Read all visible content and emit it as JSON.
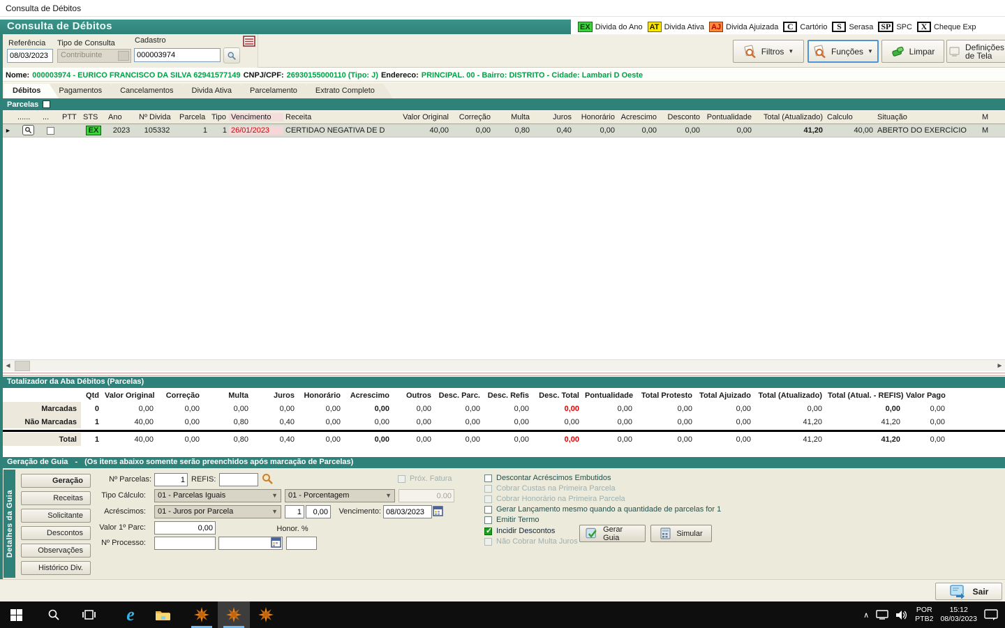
{
  "window": {
    "title": "Consulta de Débitos"
  },
  "header": {
    "title": "Consulta de Débitos"
  },
  "legend": [
    {
      "code": "EX",
      "label": "Divida do Ano"
    },
    {
      "code": "AT",
      "label": "Divida Ativa"
    },
    {
      "code": "AJ",
      "label": "Divida Ajuizada"
    },
    {
      "code": "C",
      "label": "Cartório"
    },
    {
      "code": "S",
      "label": "Serasa"
    },
    {
      "code": "SP",
      "label": "SPC"
    },
    {
      "code": "X",
      "label": "Cheque Exp"
    }
  ],
  "filters": {
    "referencia_label": "Referência",
    "referencia_value": "08/03/2023",
    "tipo_label": "Tipo de Consulta",
    "tipo_value": "Contribuinte",
    "cadastro_label": "Cadastro",
    "cadastro_value": "000003974"
  },
  "toolbar": {
    "filtros": "Filtros",
    "funcoes": "Funções",
    "limpar": "Limpar",
    "definicoes_1": "Definições",
    "definicoes_2": "de Tela"
  },
  "person": {
    "nome_label": "Nome:",
    "nome_value": "000003974 - EURICO FRANCISCO DA SILVA 62941577149",
    "cnpj_label": "CNPJ/CPF:",
    "cnpj_value": "26930155000110 (Tipo: J)",
    "endereco_label": "Endereco:",
    "endereco_value": "PRINCIPAL. 00 - Bairro: DISTRITO - Cidade: Lambari D Oeste"
  },
  "tabs": [
    "Débitos",
    "Pagamentos",
    "Cancelamentos",
    "Divida Ativa",
    "Parcelamento",
    "Extrato Completo"
  ],
  "parcelas_label": "Parcelas",
  "debitos": {
    "headers": [
      "......",
      "...",
      "PTT",
      "STS",
      "Ano",
      "Nº Divida",
      "Parcela",
      "Tipo",
      "Vencimento",
      "Receita",
      "Valor Original",
      "Correção",
      "Multa",
      "Juros",
      "Honorário",
      "Acrescimo",
      "Desconto",
      "Pontualidade",
      "Total (Atualizado)",
      "Calculo",
      "Situação",
      "M"
    ],
    "row": {
      "sts": "EX",
      "ano": "2023",
      "divida": "105332",
      "parcela": "1",
      "tipo": "1",
      "vencimento": "26/01/2023",
      "receita": "CERTIDAO NEGATIVA DE D",
      "valor_original": "40,00",
      "correcao": "0,00",
      "multa": "0,80",
      "juros": "0,40",
      "honorario": "0,00",
      "acrescimo": "0,00",
      "desconto": "0,00",
      "pontualidade": "0,00",
      "total_atualizado": "41,20",
      "calculo": "40,00",
      "situacao": "ABERTO DO EXERCÍCIO",
      "m": "M"
    }
  },
  "totalizador": {
    "title": "Totalizador da Aba Débitos (Parcelas)",
    "headers": [
      "Qtd",
      "Valor Original",
      "Correção",
      "Multa",
      "Juros",
      "Honorário",
      "Acrescimo",
      "Outros",
      "Desc. Parc.",
      "Desc. Refis",
      "Desc. Total",
      "Pontualidade",
      "Total Protesto",
      "Total Ajuizado",
      "Total (Atualizado)",
      "Total (Atual. - REFIS)",
      "Valor Pago"
    ],
    "rows": [
      {
        "label": "Marcadas",
        "values": [
          "0",
          "0,00",
          "0,00",
          "0,00",
          "0,00",
          "0,00",
          "0,00",
          "0,00",
          "0,00",
          "0,00",
          "0,00",
          "0,00",
          "0,00",
          "0,00",
          "0,00",
          "0,00",
          "0,00"
        ]
      },
      {
        "label": "Não Marcadas",
        "values": [
          "1",
          "40,00",
          "0,00",
          "0,80",
          "0,40",
          "0,00",
          "0,00",
          "0,00",
          "0,00",
          "0,00",
          "0,00",
          "0,00",
          "0,00",
          "0,00",
          "41,20",
          "41,20",
          "0,00"
        ]
      },
      {
        "label": "Total",
        "values": [
          "1",
          "40,00",
          "0,00",
          "0,80",
          "0,40",
          "0,00",
          "0,00",
          "0,00",
          "0,00",
          "0,00",
          "0,00",
          "0,00",
          "0,00",
          "0,00",
          "41,20",
          "41,20",
          "0,00"
        ]
      }
    ]
  },
  "guia": {
    "title": "Geração de Guia",
    "sep": "-",
    "note": "(Os itens abaixo somente serão preenchidos após marcação de Parcelas)",
    "side_label": "Detalhes da Guia",
    "nav": [
      "Geração",
      "Receitas",
      "Solicitante",
      "Descontos",
      "Observações",
      "Histórico Div."
    ],
    "fields": {
      "n_parcelas_label": "Nº Parcelas:",
      "n_parcelas_value": "1",
      "refis_label": "REFIS:",
      "prox_fatura_label": "Próx. Fatura",
      "tipo_calculo_label": "Tipo Cálculo:",
      "tipo_calculo_value": "01 - Parcelas Iguais",
      "porcentagem_value": "01 - Porcentagem",
      "porcentagem_field": "0.00",
      "acrescimos_label": "Acréscimos:",
      "acrescimos_value": "01 - Juros por Parcela",
      "acrescimos_n": "1",
      "acrescimos_valor": "0,00",
      "vencimento_label": "Vencimento:",
      "vencimento_value": "08/03/2023",
      "valor1_label": "Valor 1º Parc:",
      "valor1_value": "0,00",
      "honor_label": "Honor. %",
      "processo_label": "Nº Processo:"
    },
    "checkboxes": [
      {
        "label": "Descontar Acréscimos Embutidos"
      },
      {
        "label": "Cobrar Custas na Primeira Parcela"
      },
      {
        "label": "Cobrar Honorário na Primeira Parcela"
      },
      {
        "label": "Gerar Lançamento mesmo quando a quantidade de parcelas for 1"
      },
      {
        "label": "Emitir Termo"
      },
      {
        "label": "Incidir Descontos"
      },
      {
        "label": "Não Cobrar Multa Juros"
      }
    ],
    "gerar_guia": "Gerar Guia",
    "simular": "Simular"
  },
  "sair_label": "Sair",
  "taskbar": {
    "lang_top": "POR",
    "lang_bottom": "PTB2",
    "time": "15:12",
    "date": "08/03/2023"
  }
}
